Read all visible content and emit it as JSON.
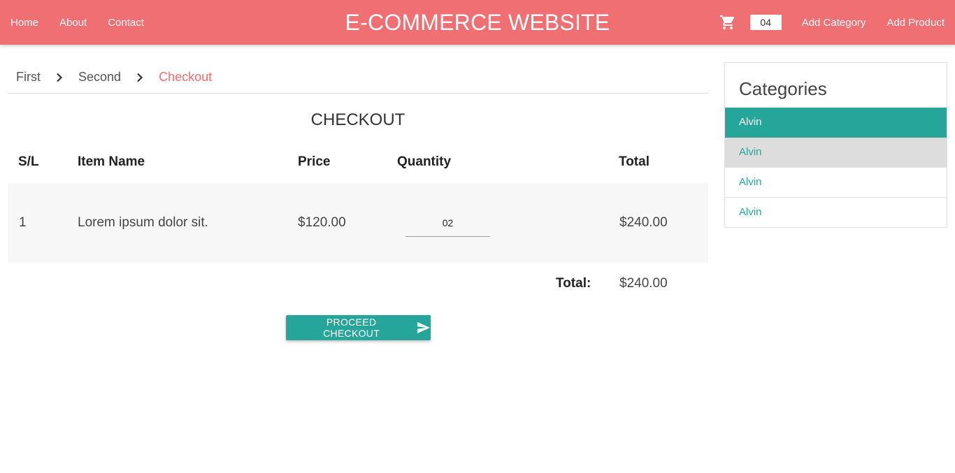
{
  "nav": {
    "links_left": [
      "Home",
      "About",
      "Contact"
    ],
    "brand": "E-COMMERCE WEBSITE",
    "cart_icon": "shopping-cart-icon",
    "cart_count": "04",
    "links_right": [
      "Add Category",
      "Add Product"
    ]
  },
  "breadcrumb": {
    "items": [
      "First",
      "Second",
      "Checkout"
    ],
    "separator_icon": "chevron-right-icon",
    "active_color": "#ef6f72"
  },
  "checkout": {
    "heading": "CHECKOUT",
    "columns": [
      "S/L",
      "Item Name",
      "Price",
      "Quantity",
      "Total"
    ],
    "rows": [
      {
        "sl": "1",
        "item": "Lorem ipsum dolor sit.",
        "price": "$120.00",
        "quantity": "02",
        "total": "$240.00"
      }
    ],
    "total_label": "Total:",
    "total_value": "$240.00",
    "button_label": "PROCEED CHECKOUT",
    "button_icon": "send-icon"
  },
  "categories": {
    "title": "Categories",
    "items": [
      "Alvin",
      "Alvin",
      "Alvin",
      "Alvin"
    ],
    "active_index": 0
  },
  "colors": {
    "navbar": "#ef6f72",
    "accent": "#26a69a",
    "row_bg": "#f7f7f7",
    "hover_bg": "#dddddd"
  }
}
